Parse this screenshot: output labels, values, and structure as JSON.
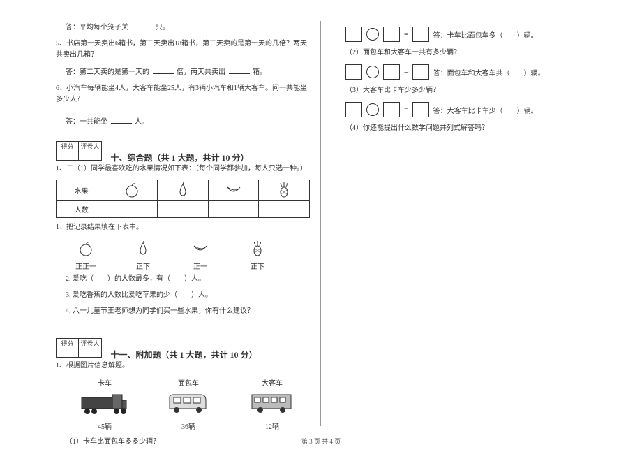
{
  "left": {
    "a1": "答：平均每个笼子关",
    "a1_tail": "只。",
    "q5": "5、书店第一天卖出6箱书，第二天卖出18箱书，第二天卖的是第一天的几倍？两天共卖出几箱？",
    "a5_1a": "答：第二天卖的是第一天的",
    "a5_1b": "倍，两天共卖出",
    "a5_1c": "箱。",
    "q6": "6、小汽车每辆能坐4人，大客车能坐25人，有3辆小汽车和1辆大客车。问一共能坐多少人？",
    "a6_1": "答：一共能坐",
    "a6_2": "人。",
    "score_label_1": "得分",
    "score_label_2": "评卷人",
    "section10_title": "十、综合题（共 1 大题，共计 10 分）",
    "q10_1": "1、二（1）同学最喜欢吃的水果情况如下表：（每个同学都参加，每人只选一种。）",
    "table_h1": "水果",
    "table_h2": "人数",
    "sub1": "1、把记录结果填在下表中。",
    "tally_1": "正正一",
    "tally_2": "正下",
    "tally_3": "正一",
    "tally_4": "正下",
    "sub2": "2. 爱吃（　　）的人数最多，有（　　）人。",
    "sub3": "3. 爱吃香蕉的人数比爱吃苹果的少（　　）人。",
    "sub4": "4. 六一儿童节王老师想为同学们买一些水果，你有什么建议？",
    "section11_title": "十一、附加题（共 1 大题，共计 10 分）",
    "q11_1": "1、根据图片信息解题。",
    "veh1_label": "卡车",
    "veh2_label": "面包车",
    "veh3_label": "大客车",
    "veh1_count": "45辆",
    "veh2_count": "36辆",
    "veh3_count": "12辆",
    "q11_sub1": "（1）卡车比面包车多多少辆？"
  },
  "right": {
    "r1_ans": "答：卡车比面包车多（　　）辆。",
    "r2_q": "（2）面包车和大客车一共有多少辆？",
    "r2_ans": "答：面包车和大客车共（　　）辆。",
    "r3_q": "（3）大客车比卡车少多少辆？",
    "r3_ans": "答：大客车比卡车少（　　）辆。",
    "r4_q": "（4）你还能提出什么数学问题并列式解答吗？"
  },
  "footer": "第 3 页  共 4 页",
  "chart_data": [
    {
      "type": "table",
      "title": "二（1）同学最喜欢吃的水果情况",
      "categories": [
        "橘子",
        "梨",
        "香蕉",
        "菠萝"
      ],
      "tally_values": [
        11,
        7,
        6,
        7
      ],
      "note": "values estimated from tally marks 正正一/正下/正一/正下"
    },
    {
      "type": "bar",
      "title": "车辆数量",
      "categories": [
        "卡车",
        "面包车",
        "大客车"
      ],
      "values": [
        45,
        36,
        12
      ],
      "xlabel": "",
      "ylabel": "辆"
    }
  ]
}
